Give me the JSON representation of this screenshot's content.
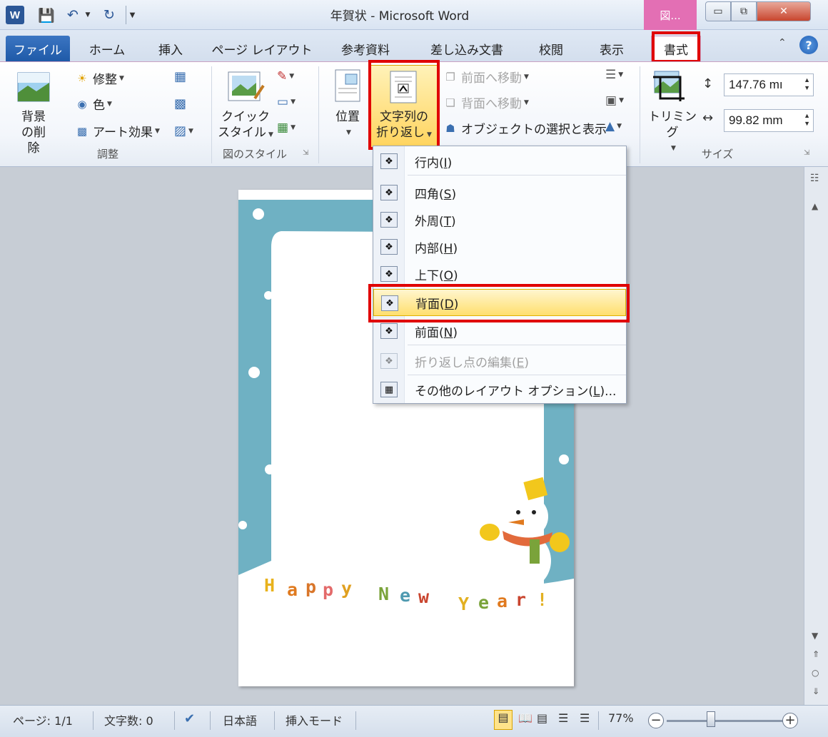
{
  "window": {
    "title": "年賀状 - Microsoft Word",
    "context_tab_title": "図...",
    "word_icon": "W",
    "buttons": {
      "minimize": "▭",
      "maximize": "⧉",
      "close": "✕"
    }
  },
  "tabs": [
    {
      "label": "ファイル"
    },
    {
      "label": "ホーム"
    },
    {
      "label": "挿入"
    },
    {
      "label": "ページ レイアウト"
    },
    {
      "label": "参考資料"
    },
    {
      "label": "差し込み文書"
    },
    {
      "label": "校閲"
    },
    {
      "label": "表示"
    },
    {
      "label": "書式"
    }
  ],
  "help": "?",
  "ribbon": {
    "adjust": {
      "remove_bg": "背景の削除",
      "corrections": "修整",
      "color": "色",
      "artistic": "アート効果",
      "group_label": "調整"
    },
    "styles": {
      "quick_styles_line1": "クイック",
      "quick_styles_line2": "スタイル",
      "group_label": "図のスタイル"
    },
    "arrange": {
      "position": "位置",
      "wrap_line1": "文字列の",
      "wrap_line2": "折り返し",
      "bring_forward": "前面へ移動",
      "send_backward": "背面へ移動",
      "selection_pane": "オブジェクトの選択と表示"
    },
    "size": {
      "crop": "トリミング",
      "height": "147.76 mı",
      "width": "99.82 mm",
      "group_label": "サイズ"
    }
  },
  "wrap_menu": {
    "items": [
      {
        "label": "行内",
        "key": "I",
        "disabled": false
      },
      {
        "label": "四角",
        "key": "S",
        "disabled": false
      },
      {
        "label": "外周",
        "key": "T",
        "disabled": false
      },
      {
        "label": "内部",
        "key": "H",
        "disabled": false
      },
      {
        "label": "上下",
        "key": "O",
        "disabled": false
      },
      {
        "label": "背面",
        "key": "D",
        "disabled": false,
        "selected": true
      },
      {
        "label": "前面",
        "key": "N",
        "disabled": false
      },
      {
        "label": "折り返し点の編集",
        "key": "E",
        "disabled": true
      },
      {
        "label": "その他のレイアウト オプション",
        "key": "L",
        "suffix": "...",
        "disabled": false
      }
    ]
  },
  "card": {
    "letters": [
      "H",
      "a",
      "p",
      "p",
      "y",
      "N",
      "e",
      "w",
      "Y",
      "e",
      "a",
      "r",
      "!"
    ],
    "colors": {
      "H": "#e8b21c",
      "a1": "#e07a1f",
      "p1": "#d9762a",
      "p2": "#e36a6a",
      "y1": "#e0a020",
      "N": "#7aa33a",
      "e1": "#4f9ab0",
      "w": "#c9452f",
      "Y": "#e2b021",
      "e2": "#7aa33a",
      "a2": "#e07a1f",
      "r": "#c9452f",
      "ex": "#e2b021"
    },
    "frame_color": "#6fb1c3"
  },
  "status": {
    "page": "ページ: 1/1",
    "words": "文字数: 0",
    "language": "日本語",
    "mode": "挿入モード",
    "zoom": "77%"
  },
  "colors": {
    "highlight": "#e00000",
    "context_tab": "#e36fb4",
    "file_tab": "#2a62ae"
  }
}
